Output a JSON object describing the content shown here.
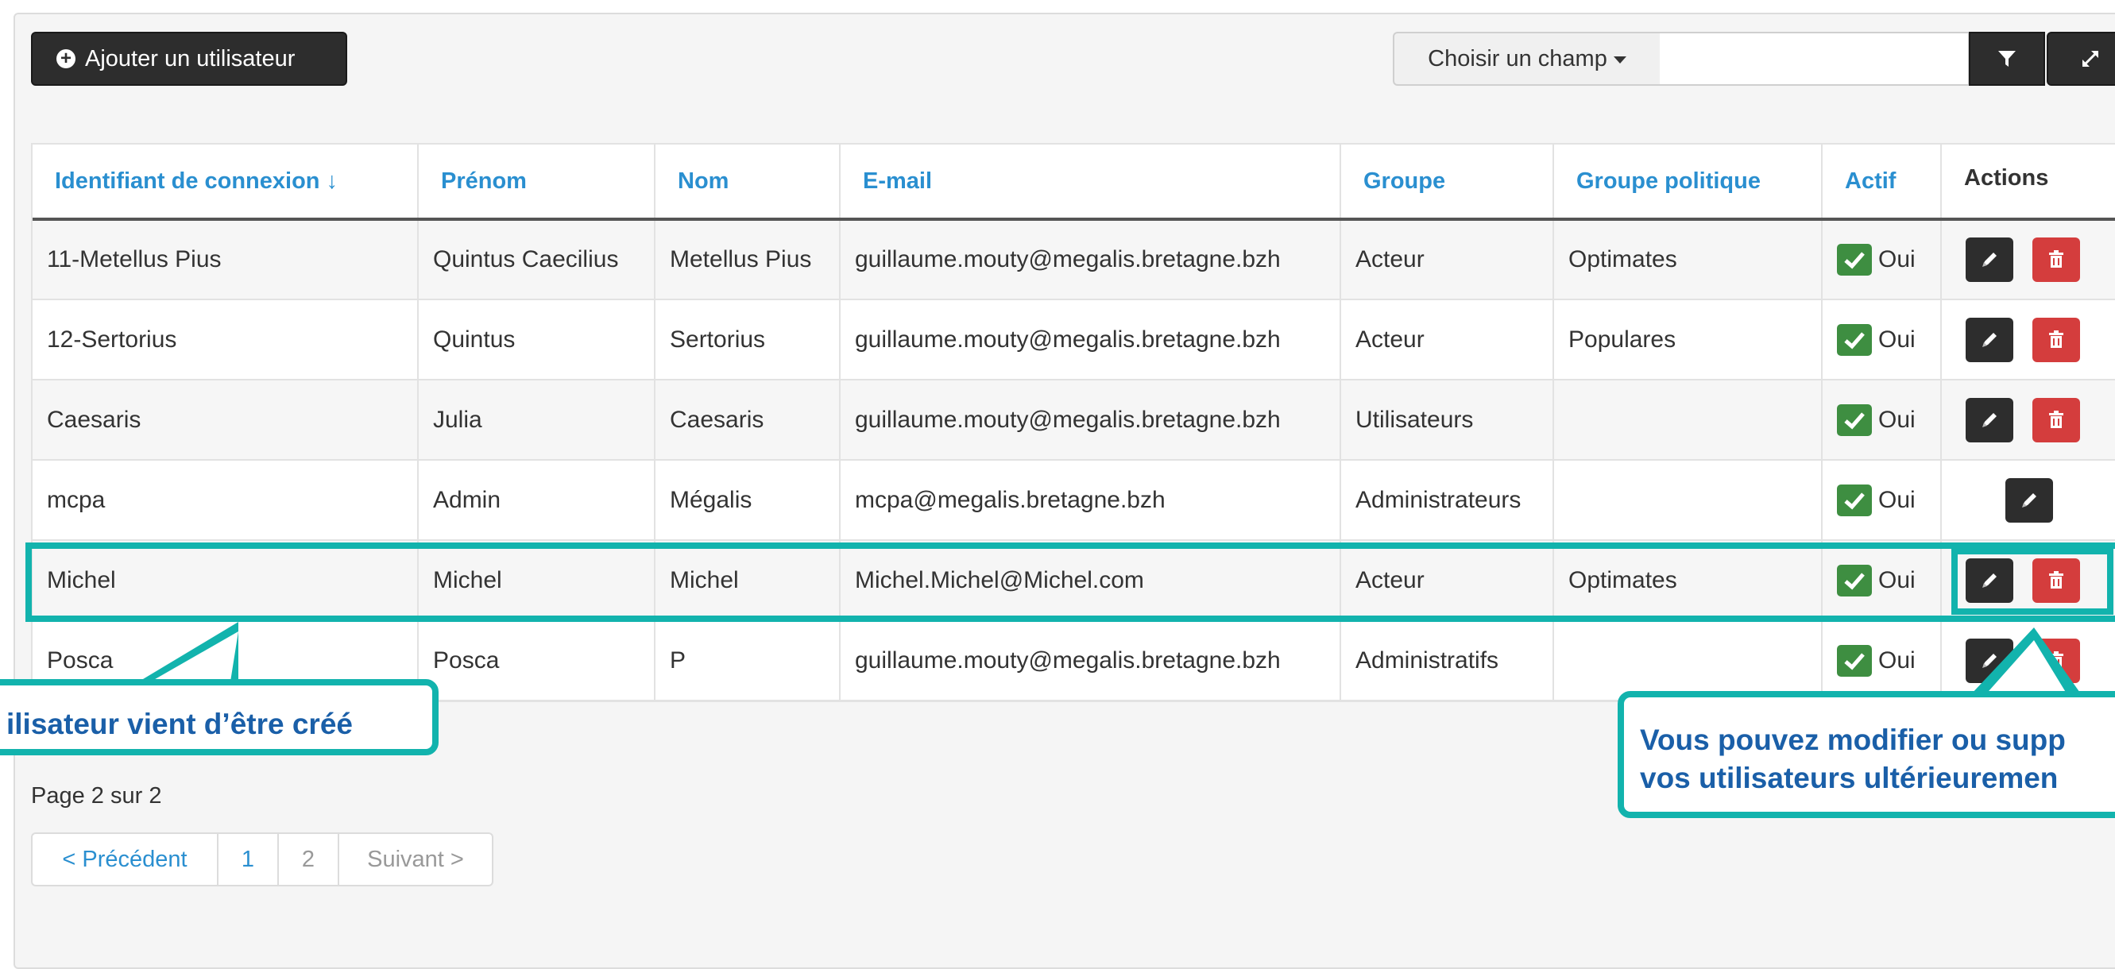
{
  "toolbar": {
    "add_user_label": "Ajouter un utilisateur",
    "field_select_label": "Choisir un champ",
    "search_value": ""
  },
  "table": {
    "headers": [
      "Identifiant de connexion ↓",
      "Prénom",
      "Nom",
      "E-mail",
      "Groupe",
      "Groupe politique",
      "Actif",
      "Actions"
    ],
    "rows": [
      [
        "11-Metellus Pius",
        "Quintus Caecilius",
        "Metellus Pius",
        "guillaume.mouty@megalis.bretagne.bzh",
        "Acteur",
        "Optimates",
        "Oui"
      ],
      [
        "12-Sertorius",
        "Quintus",
        "Sertorius",
        "guillaume.mouty@megalis.bretagne.bzh",
        "Acteur",
        "Populares",
        "Oui"
      ],
      [
        "Caesaris",
        "Julia",
        "Caesaris",
        "guillaume.mouty@megalis.bretagne.bzh",
        "Utilisateurs",
        "",
        "Oui"
      ],
      [
        "mcpa",
        "Admin",
        "Mégalis",
        "mcpa@megalis.bretagne.bzh",
        "Administrateurs",
        "",
        "Oui"
      ],
      [
        "Michel",
        "Michel",
        "Michel",
        "Michel.Michel@Michel.com",
        "Acteur",
        "Optimates",
        "Oui"
      ],
      [
        "Posca",
        "Posca",
        "P",
        "guillaume.mouty@megalis.bretagne.bzh",
        "Administratifs",
        "",
        "Oui"
      ]
    ]
  },
  "callouts": {
    "created": "ilisateur vient d’être créé",
    "modify_line1": "Vous pouvez modifier ou supp",
    "modify_line2": "vos utilisateurs ultérieuremen"
  },
  "pagination": {
    "info": "Page 2 sur 2",
    "prev": "< Précédent",
    "page1": "1",
    "page2": "2",
    "next": "Suivant >"
  },
  "colors": {
    "accent_teal": "#12b3ad",
    "link_blue": "#2a8fd0",
    "callout_text": "#1a5fa8",
    "active_green": "#3e8e41",
    "delete_red": "#d43d3d",
    "dark_button": "#2d2d2d"
  }
}
